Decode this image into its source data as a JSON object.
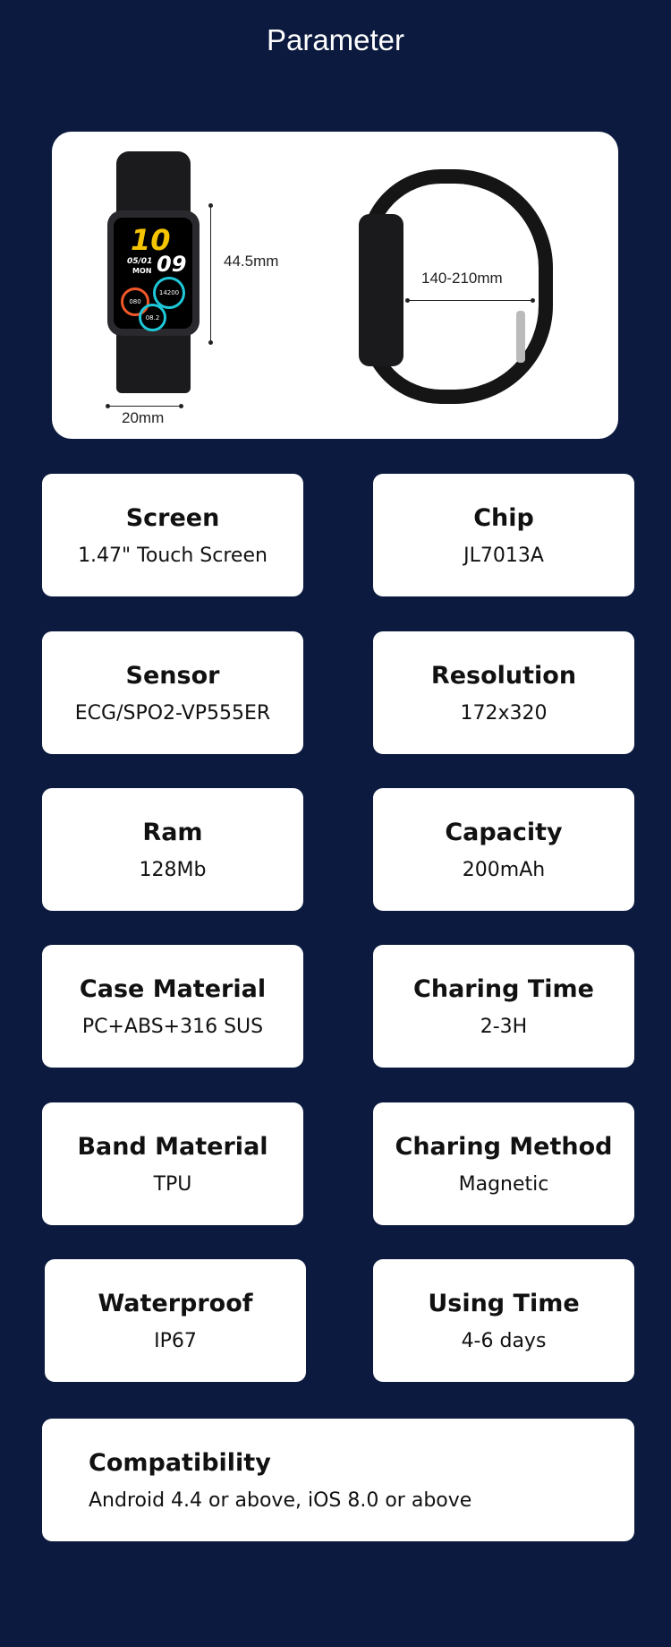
{
  "header": {
    "title": "Parameter"
  },
  "product_image": {
    "watch_face": {
      "hour": "10",
      "minute": "09",
      "date": "05/01",
      "day": "MON",
      "steps": "14200",
      "heart_rate": "080",
      "distance": "08.2"
    },
    "dimensions": {
      "height": "44.5mm",
      "width": "20mm",
      "strap": "140-210mm"
    }
  },
  "specs": [
    {
      "label": "Screen",
      "value": "1.47\" Touch Screen"
    },
    {
      "label": "Chip",
      "value": "JL7013A"
    },
    {
      "label": "Sensor",
      "value": "ECG/SPO2-VP555ER"
    },
    {
      "label": "Resolution",
      "value": "172x320"
    },
    {
      "label": "Ram",
      "value": "128Mb"
    },
    {
      "label": "Capacity",
      "value": "200mAh"
    },
    {
      "label": "Case Material",
      "value": "PC+ABS+316 SUS"
    },
    {
      "label": "Charing Time",
      "value": "2-3H"
    },
    {
      "label": "Band Material",
      "value": "TPU"
    },
    {
      "label": "Charing Method",
      "value": "Magnetic"
    },
    {
      "label": "Waterproof",
      "value": "IP67"
    },
    {
      "label": "Using Time",
      "value": "4-6 days"
    }
  ],
  "compatibility": {
    "label": "Compatibility",
    "value": "Android 4.4 or above, iOS 8.0 or above"
  },
  "colors": {
    "background": "#0b1a3e",
    "card": "#ffffff",
    "accent_yellow": "#f5c400",
    "ring_cyan": "#1ec8d8",
    "ring_orange": "#f0582a"
  }
}
